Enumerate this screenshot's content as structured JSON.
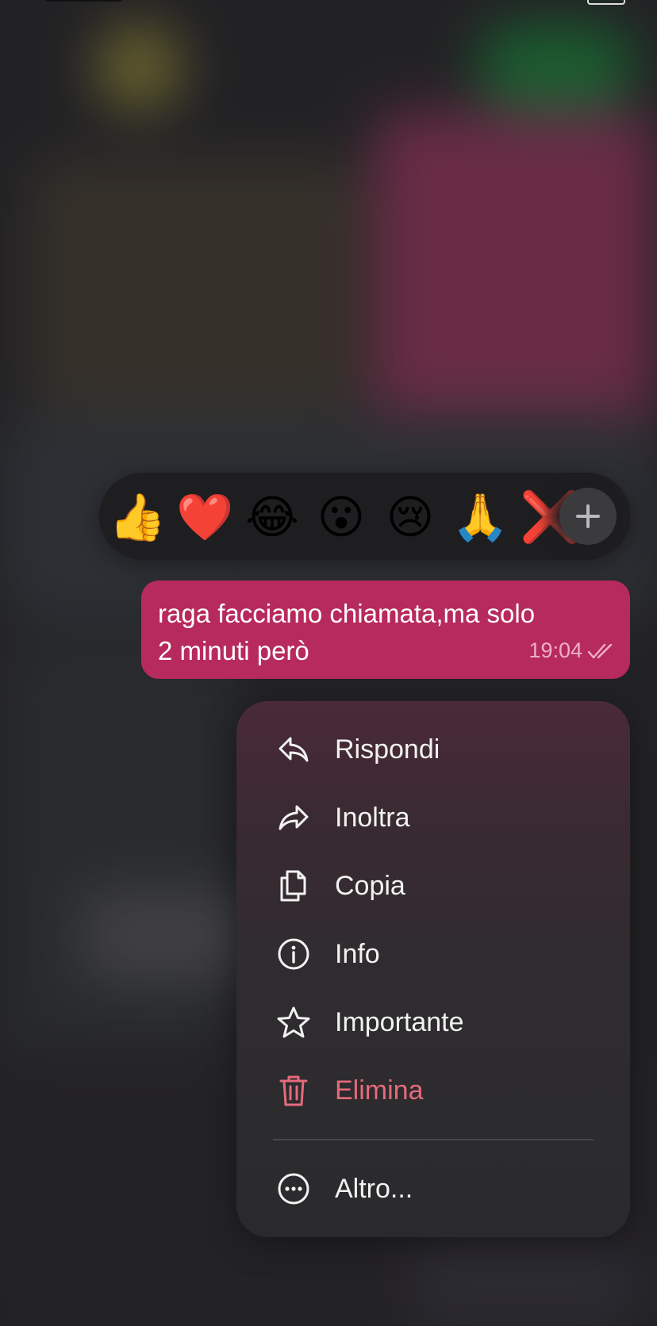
{
  "reactions": [
    {
      "emoji": "👍",
      "name": "thumbs-up"
    },
    {
      "emoji": "❤️",
      "name": "red-heart"
    },
    {
      "emoji": "😂",
      "name": "tears-of-joy"
    },
    {
      "emoji": "😮",
      "name": "face-open-mouth"
    },
    {
      "emoji": "😢",
      "name": "crying-face"
    },
    {
      "emoji": "🙏",
      "name": "folded-hands"
    },
    {
      "emoji": "❌",
      "name": "cross-mark"
    }
  ],
  "add_reaction_icon": "plus-icon",
  "message": {
    "text": "raga facciamo chiamata,ma solo\n2 minuti però",
    "time": "19:04",
    "status_icon": "double-check-icon"
  },
  "menu": {
    "items": [
      {
        "label": "Rispondi",
        "icon": "reply-icon"
      },
      {
        "label": "Inoltra",
        "icon": "forward-icon"
      },
      {
        "label": "Copia",
        "icon": "copy-icon"
      },
      {
        "label": "Info",
        "icon": "info-icon"
      },
      {
        "label": "Importante",
        "icon": "star-icon"
      },
      {
        "label": "Elimina",
        "icon": "trash-icon",
        "danger": true
      },
      {
        "label": "Altro...",
        "icon": "more-icon"
      }
    ]
  },
  "colors": {
    "bubble": "#b72a5c",
    "danger": "#e66a7b",
    "reaction_bar": "#1e1e20"
  }
}
